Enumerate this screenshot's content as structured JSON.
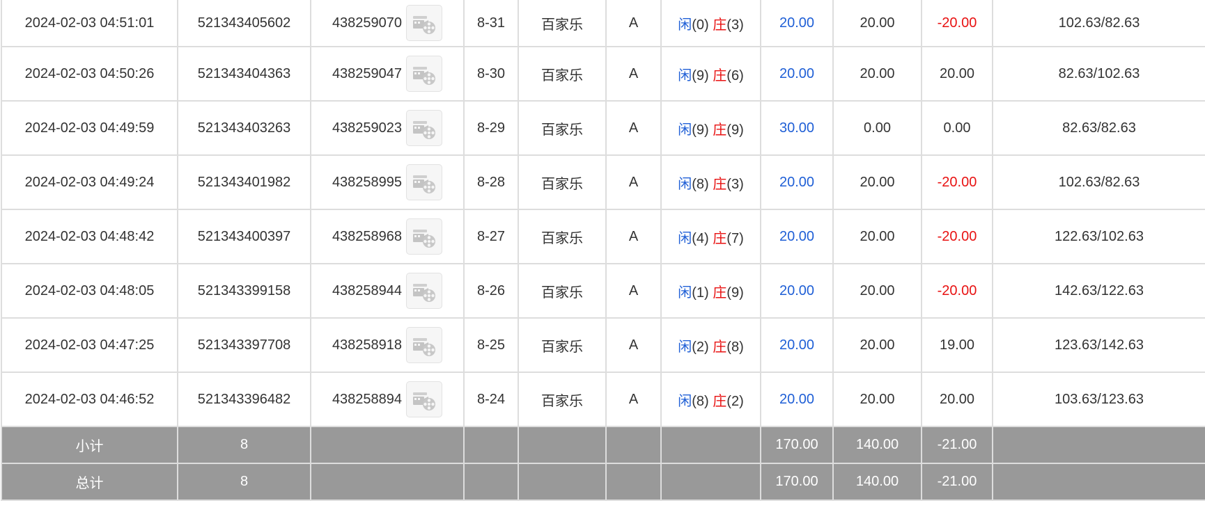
{
  "colors": {
    "blue": "#1f5fd6",
    "red": "#e81212",
    "footer_bg": "#999999",
    "border": "#dddddd"
  },
  "icons": {
    "replay": "film-reel-icon"
  },
  "rows": [
    {
      "time": "2024-02-03 04:51:01",
      "order_no": "521343405602",
      "round_no": "438259070",
      "shoe": "8-31",
      "game": "百家乐",
      "table": "A",
      "player_label": "闲",
      "player_points": "(0)",
      "banker_label": "庄",
      "banker_points": "(3)",
      "bet": "20.00",
      "valid_bet": "20.00",
      "payout": "-20.00",
      "payout_negative": true,
      "balance": "102.63/82.63"
    },
    {
      "time": "2024-02-03 04:50:26",
      "order_no": "521343404363",
      "round_no": "438259047",
      "shoe": "8-30",
      "game": "百家乐",
      "table": "A",
      "player_label": "闲",
      "player_points": "(9)",
      "banker_label": "庄",
      "banker_points": "(6)",
      "bet": "20.00",
      "valid_bet": "20.00",
      "payout": "20.00",
      "payout_negative": false,
      "balance": "82.63/102.63"
    },
    {
      "time": "2024-02-03 04:49:59",
      "order_no": "521343403263",
      "round_no": "438259023",
      "shoe": "8-29",
      "game": "百家乐",
      "table": "A",
      "player_label": "闲",
      "player_points": "(9)",
      "banker_label": "庄",
      "banker_points": "(9)",
      "bet": "30.00",
      "valid_bet": "0.00",
      "payout": "0.00",
      "payout_negative": false,
      "balance": "82.63/82.63"
    },
    {
      "time": "2024-02-03 04:49:24",
      "order_no": "521343401982",
      "round_no": "438258995",
      "shoe": "8-28",
      "game": "百家乐",
      "table": "A",
      "player_label": "闲",
      "player_points": "(8)",
      "banker_label": "庄",
      "banker_points": "(3)",
      "bet": "20.00",
      "valid_bet": "20.00",
      "payout": "-20.00",
      "payout_negative": true,
      "balance": "102.63/82.63"
    },
    {
      "time": "2024-02-03 04:48:42",
      "order_no": "521343400397",
      "round_no": "438258968",
      "shoe": "8-27",
      "game": "百家乐",
      "table": "A",
      "player_label": "闲",
      "player_points": "(4)",
      "banker_label": "庄",
      "banker_points": "(7)",
      "bet": "20.00",
      "valid_bet": "20.00",
      "payout": "-20.00",
      "payout_negative": true,
      "balance": "122.63/102.63"
    },
    {
      "time": "2024-02-03 04:48:05",
      "order_no": "521343399158",
      "round_no": "438258944",
      "shoe": "8-26",
      "game": "百家乐",
      "table": "A",
      "player_label": "闲",
      "player_points": "(1)",
      "banker_label": "庄",
      "banker_points": "(9)",
      "bet": "20.00",
      "valid_bet": "20.00",
      "payout": "-20.00",
      "payout_negative": true,
      "balance": "142.63/122.63"
    },
    {
      "time": "2024-02-03 04:47:25",
      "order_no": "521343397708",
      "round_no": "438258918",
      "shoe": "8-25",
      "game": "百家乐",
      "table": "A",
      "player_label": "闲",
      "player_points": "(2)",
      "banker_label": "庄",
      "banker_points": "(8)",
      "bet": "20.00",
      "valid_bet": "20.00",
      "payout": "19.00",
      "payout_negative": false,
      "balance": "123.63/142.63"
    },
    {
      "time": "2024-02-03 04:46:52",
      "order_no": "521343396482",
      "round_no": "438258894",
      "shoe": "8-24",
      "game": "百家乐",
      "table": "A",
      "player_label": "闲",
      "player_points": "(8)",
      "banker_label": "庄",
      "banker_points": "(2)",
      "bet": "20.00",
      "valid_bet": "20.00",
      "payout": "20.00",
      "payout_negative": false,
      "balance": "103.63/123.63"
    }
  ],
  "subtotal": {
    "label": "小计",
    "count": "8",
    "bet": "170.00",
    "valid_bet": "140.00",
    "payout": "-21.00"
  },
  "total": {
    "label": "总计",
    "count": "8",
    "bet": "170.00",
    "valid_bet": "140.00",
    "payout": "-21.00"
  }
}
